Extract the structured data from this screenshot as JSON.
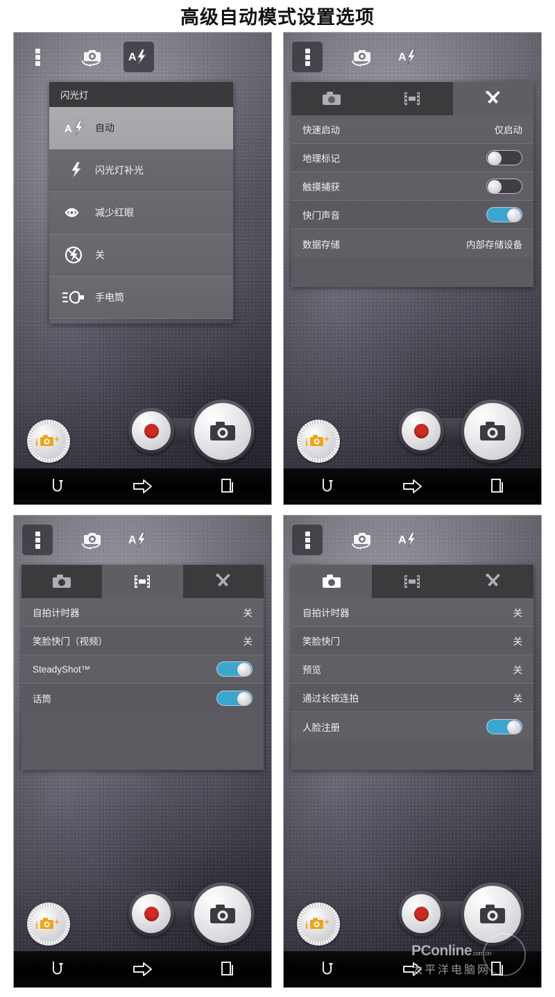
{
  "title": "高级自动模式设置选项",
  "toolbar": {
    "menu_icon": "overflow-menu-icon",
    "switch_camera_icon": "switch-camera-icon",
    "flash_icon": "flash-auto-icon"
  },
  "capture": {
    "mode_dial_label": "i+",
    "record_button": "record-button",
    "shutter_button": "shutter-button"
  },
  "navbar": {
    "back": "back-icon",
    "home": "home-icon",
    "recents": "recents-icon"
  },
  "tabs": {
    "photo": "camera-tab",
    "video": "video-tab",
    "tools": "tools-tab"
  },
  "panels": [
    {
      "id": "panel-flash-menu",
      "active_toolbar_button": "flash",
      "popup": {
        "header": "闪光灯",
        "items": [
          {
            "icon": "flash-auto-icon",
            "label": "自动",
            "selected": true
          },
          {
            "icon": "flash-on-icon",
            "label": "闪光灯补光",
            "selected": false
          },
          {
            "icon": "red-eye-icon",
            "label": "减少红眼",
            "selected": false
          },
          {
            "icon": "flash-off-icon",
            "label": "关",
            "selected": false
          },
          {
            "icon": "flashlight-icon",
            "label": "手电筒",
            "selected": false
          }
        ]
      }
    },
    {
      "id": "panel-tools-settings",
      "active_toolbar_button": "menu",
      "active_tab": "tools",
      "rows": [
        {
          "label": "快速启动",
          "type": "value",
          "value": "仅启动"
        },
        {
          "label": "地理标记",
          "type": "toggle",
          "on": false
        },
        {
          "label": "触摸捕获",
          "type": "toggle",
          "on": false
        },
        {
          "label": "快门声音",
          "type": "toggle",
          "on": true
        },
        {
          "label": "数据存储",
          "type": "value",
          "value": "内部存储设备"
        }
      ]
    },
    {
      "id": "panel-video-settings",
      "active_toolbar_button": "menu",
      "active_tab": "video",
      "rows": [
        {
          "label": "自拍计时器",
          "type": "value",
          "value": "关"
        },
        {
          "label": "笑脸快门（视频）",
          "type": "value",
          "value": "关"
        },
        {
          "label": "SteadyShot™",
          "type": "toggle",
          "on": true
        },
        {
          "label": "话筒",
          "type": "toggle",
          "on": true
        }
      ]
    },
    {
      "id": "panel-photo-settings",
      "active_toolbar_button": "menu",
      "active_tab": "photo",
      "rows": [
        {
          "label": "自拍计时器",
          "type": "value",
          "value": "关"
        },
        {
          "label": "笑脸快门",
          "type": "value",
          "value": "关"
        },
        {
          "label": "预览",
          "type": "value",
          "value": "关"
        },
        {
          "label": "通过长按连拍",
          "type": "value",
          "value": "关"
        },
        {
          "label": "人脸注册",
          "type": "toggle",
          "on": true
        }
      ]
    }
  ],
  "watermark": {
    "brand": "PConline",
    "domain": ".com.cn",
    "chinese": "太平洋电脑网"
  },
  "colors": {
    "toggle_on": "#3ba7cf",
    "record_red": "#cc2a22",
    "dial_accent": "#f0a41a",
    "tab_active": "#5e5e63",
    "tab_inactive": "#3b3b3e"
  }
}
